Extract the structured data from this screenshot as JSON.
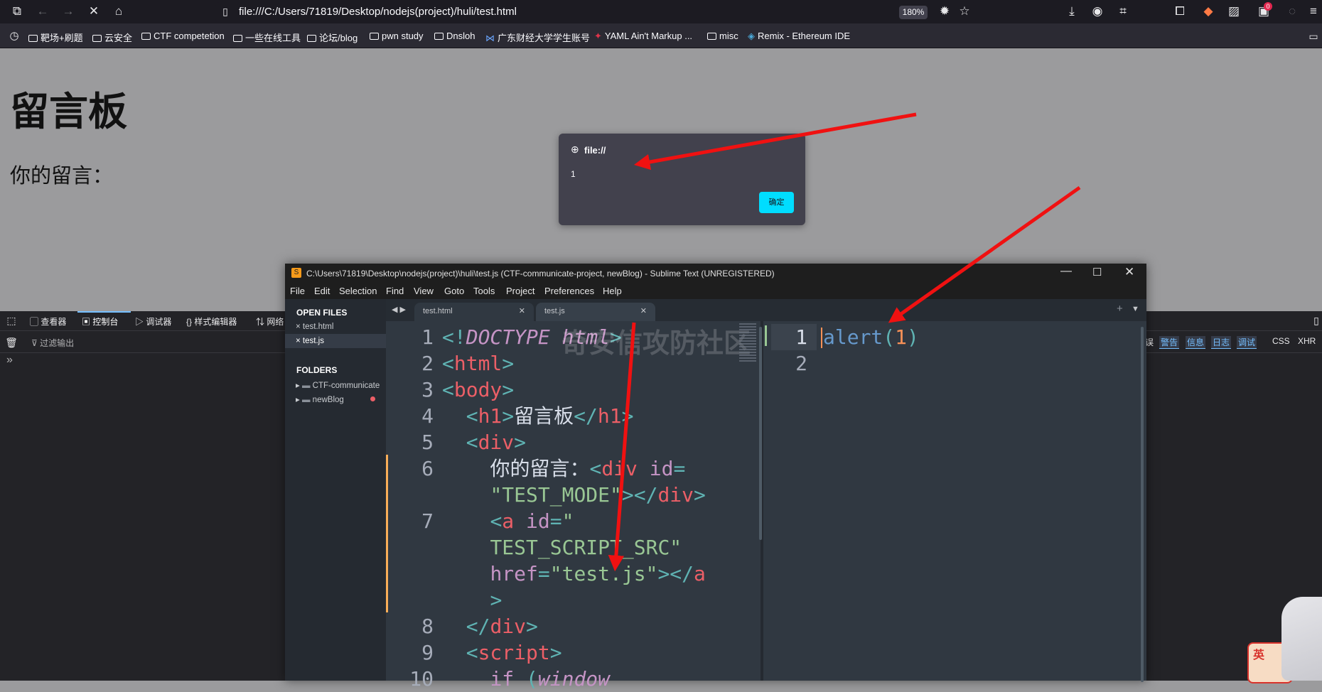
{
  "browser": {
    "url": "file:///C:/Users/71819/Desktop/nodejs(project)/huli/test.html",
    "zoom": "180%",
    "notification_count": "0",
    "bookmarks": [
      "靶场+刷题",
      "云安全",
      "CTF competetion",
      "一些在线工具",
      "论坛/blog",
      "pwn study",
      "Dnsloh",
      "广东财经大学学生账号",
      "YAML Ain't Markup ...",
      "misc",
      "Remix - Ethereum IDE"
    ]
  },
  "page": {
    "heading": "留言板",
    "message_label": "你的留言："
  },
  "alert": {
    "origin": "file://",
    "message": "1",
    "ok_label": "确定"
  },
  "devtools": {
    "tabs": [
      "查看器",
      "控制台",
      "调试器",
      "样式编辑器",
      "网络"
    ],
    "filter_placeholder": "过滤输出",
    "prompt": "»",
    "levels": [
      "误",
      "警告",
      "信息",
      "日志",
      "调试"
    ],
    "extra": [
      "CSS",
      "XHR"
    ]
  },
  "sublime": {
    "title": "C:\\Users\\71819\\Desktop\\nodejs(project)\\huli\\test.js (CTF-communicate-project, newBlog) - Sublime Text (UNREGISTERED)",
    "menu": [
      "File",
      "Edit",
      "Selection",
      "Find",
      "View",
      "Goto",
      "Tools",
      "Project",
      "Preferences",
      "Help"
    ],
    "sidebar": {
      "open_files_heading": "OPEN FILES",
      "open_files": [
        "test.html",
        "test.js"
      ],
      "folders_heading": "FOLDERS",
      "folders": [
        "CTF-communicate",
        "newBlog"
      ]
    },
    "tabs": [
      "test.html",
      "test.js"
    ],
    "left_line_numbers": [
      "1",
      "2",
      "3",
      "4",
      "5",
      "6",
      "",
      "7",
      "",
      "",
      "",
      "8",
      "9",
      "10"
    ],
    "right_line_numbers": [
      "1",
      "2"
    ],
    "left_code": {
      "l1_open": "<!",
      "l1_doctype": "DOCTYPE",
      "l1_html": "html",
      "l1_close": ">",
      "l2": "html",
      "l3": "body",
      "l4_tag": "h1",
      "l4_text": "留言板",
      "l5": "div",
      "l6_text": "你的留言：",
      "l6_tag": "div",
      "l6_attr": "id",
      "l6b_val": "\"TEST_MODE\"",
      "l7_tag": "a",
      "l7_attr": "id",
      "l7_q": "\"",
      "l7b_val": "TEST_SCRIPT_SRC\"",
      "l7c_attr": "href",
      "l7c_val": "\"test.js\"",
      "l7c_end": "a",
      "l7d": ">",
      "l8": "div",
      "l9": "script",
      "l10_kw": "if",
      "l10_obj": "window"
    },
    "right_code": {
      "fn": "alert",
      "arg": "1"
    },
    "watermark": "奇安信攻防社区"
  },
  "ime": {
    "label": "英"
  }
}
